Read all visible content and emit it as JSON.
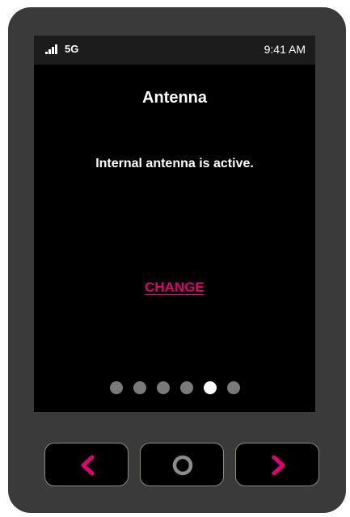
{
  "status_bar": {
    "network": "5G",
    "time": "9:41 AM",
    "signal_icon": "signal-bars-icon"
  },
  "screen": {
    "title": "Antenna",
    "message": "Internal antenna is active.",
    "change_label": "CHANGE"
  },
  "pagination": {
    "total": 6,
    "active_index": 4
  },
  "buttons": {
    "back_icon": "chevron-left-icon",
    "home_icon": "circle-icon",
    "next_icon": "chevron-right-icon"
  },
  "colors": {
    "accent": "#e20074",
    "device_body": "#3a3a3a",
    "screen_background": "#000000",
    "dot_inactive": "#7a7a7a",
    "dot_active": "#ffffff"
  }
}
